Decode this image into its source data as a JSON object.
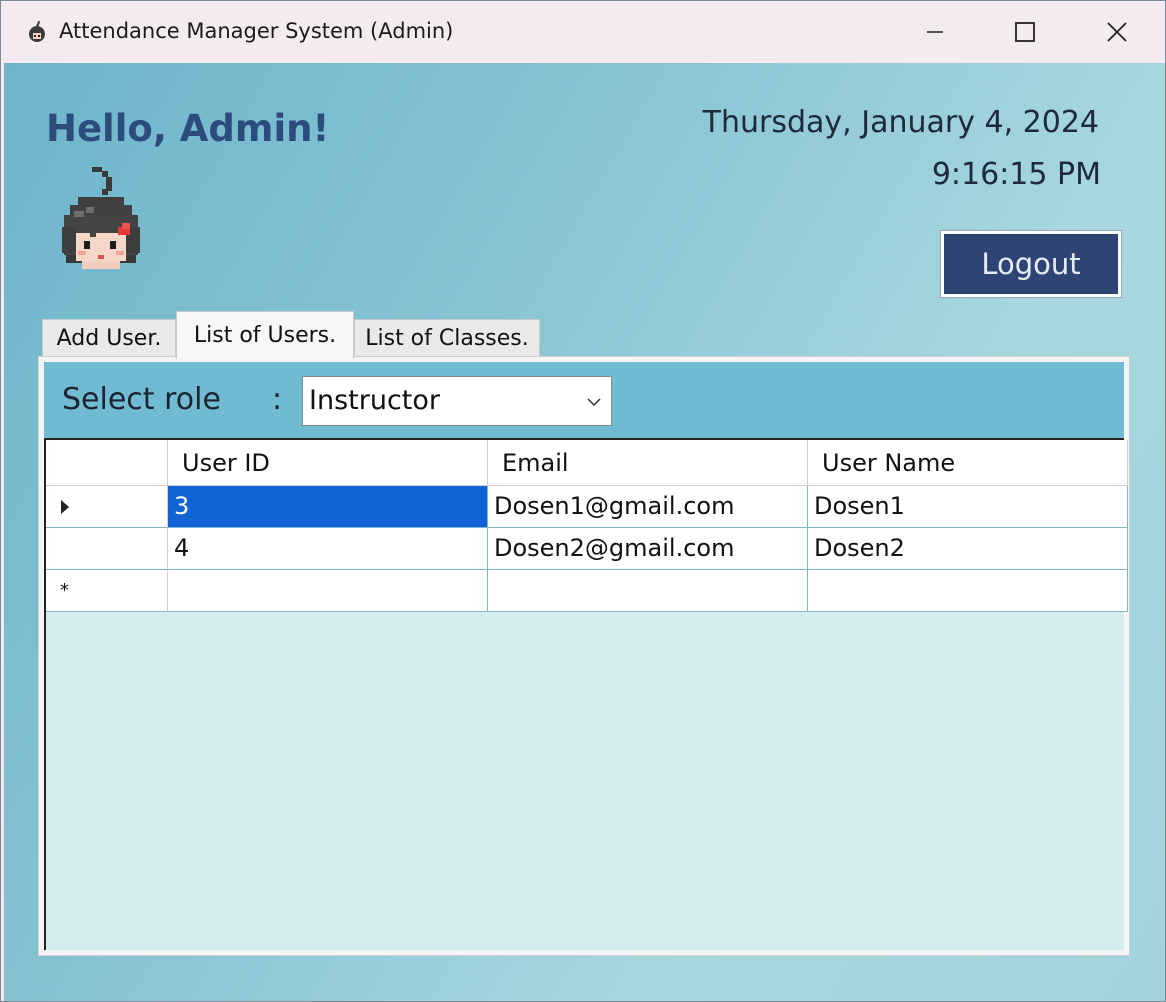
{
  "window": {
    "title": "Attendance Manager System (Admin)",
    "controls": {
      "minimize_icon": "minimize-icon",
      "maximize_icon": "maximize-icon",
      "close_icon": "close-icon"
    }
  },
  "header": {
    "greeting": "Hello, Admin!",
    "date": "Thursday, January 4, 2024",
    "time": "9:16:15 PM",
    "logout_label": "Logout"
  },
  "tabs": [
    {
      "label": "Add User.",
      "active": false
    },
    {
      "label": "List of Users.",
      "active": true
    },
    {
      "label": "List of Classes.",
      "active": false
    }
  ],
  "filter": {
    "label": "Select role",
    "colon": ":",
    "selected": "Instructor"
  },
  "grid": {
    "columns": [
      "User ID",
      "Email",
      "User Name"
    ],
    "rows": [
      {
        "user_id": "3",
        "email": "Dosen1@gmail.com",
        "user_name": "Dosen1",
        "current": true
      },
      {
        "user_id": "4",
        "email": "Dosen2@gmail.com",
        "user_name": "Dosen2",
        "current": false
      }
    ],
    "new_row_marker": "*"
  },
  "colors": {
    "greeting": "#2c4c7e",
    "logout_bg": "#2e4474",
    "filter_bar": "#70bbd2",
    "selected_cell": "#1064d6"
  }
}
